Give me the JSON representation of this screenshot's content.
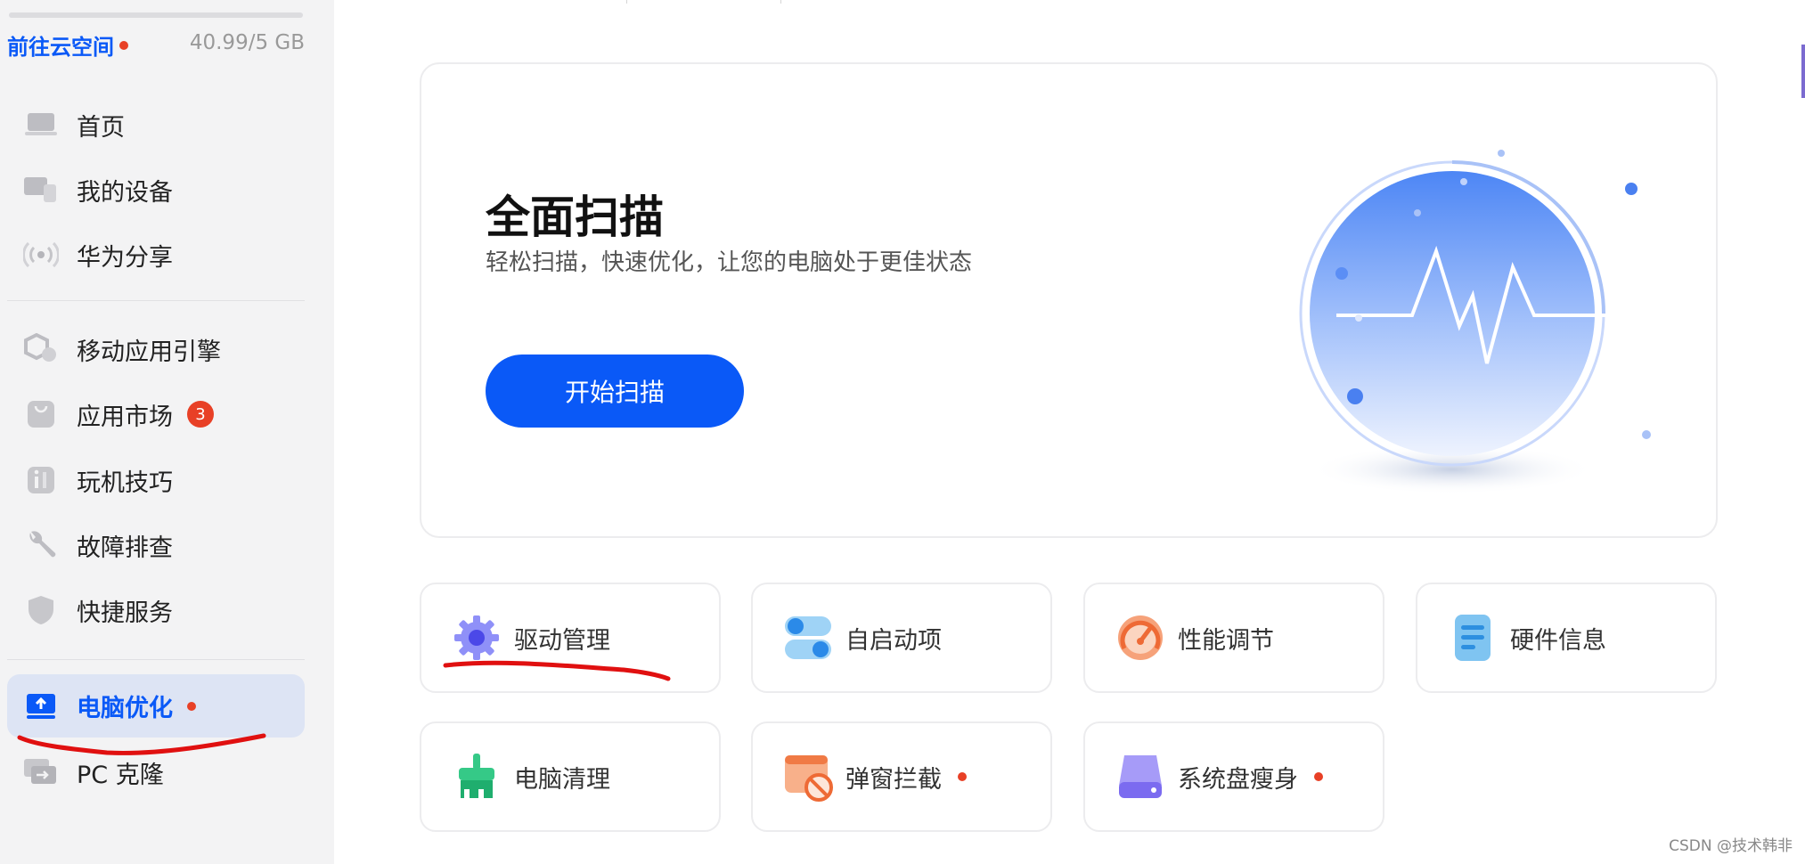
{
  "sidebar": {
    "cloud_link": "前往云空间",
    "storage": "40.99/5 GB",
    "items": [
      {
        "label": "首页",
        "icon": "laptop-icon"
      },
      {
        "label": "我的设备",
        "icon": "devices-icon"
      },
      {
        "label": "华为分享",
        "icon": "share-wave-icon"
      },
      {
        "label": "移动应用引擎",
        "icon": "hexagon-engine-icon"
      },
      {
        "label": "应用市场",
        "icon": "shopping-bag-icon",
        "badge": "3"
      },
      {
        "label": "玩机技巧",
        "icon": "tips-icon"
      },
      {
        "label": "故障排查",
        "icon": "wrench-icon"
      },
      {
        "label": "快捷服务",
        "icon": "shield-icon"
      },
      {
        "label": "电脑优化",
        "icon": "pc-optimize-icon",
        "active": true
      },
      {
        "label": "PC 克隆",
        "icon": "pc-clone-icon"
      }
    ]
  },
  "scan": {
    "title": "全面扫描",
    "subtitle": "轻松扫描，快速优化，让您的电脑处于更佳状态",
    "button": "开始扫描"
  },
  "tools": [
    {
      "label": "驱动管理",
      "icon": "gear-icon",
      "color": "#6b6cf5"
    },
    {
      "label": "自启动项",
      "icon": "toggle-switch-icon",
      "color": "#2b8ae8"
    },
    {
      "label": "性能调节",
      "icon": "gauge-icon",
      "color": "#f07a45"
    },
    {
      "label": "硬件信息",
      "icon": "document-icon",
      "color": "#3ea2e8"
    },
    {
      "label": "电脑清理",
      "icon": "broom-icon",
      "color": "#2fc07a"
    },
    {
      "label": "弹窗拦截",
      "icon": "popup-block-icon",
      "color": "#f07a45"
    },
    {
      "label": "系统盘瘦身",
      "icon": "disk-icon",
      "color": "#7b6bf0"
    }
  ],
  "colors": {
    "accent": "#0a59f7",
    "alert": "#e84026",
    "annotation": "#e01010"
  },
  "watermark": "CSDN @技术韩非"
}
